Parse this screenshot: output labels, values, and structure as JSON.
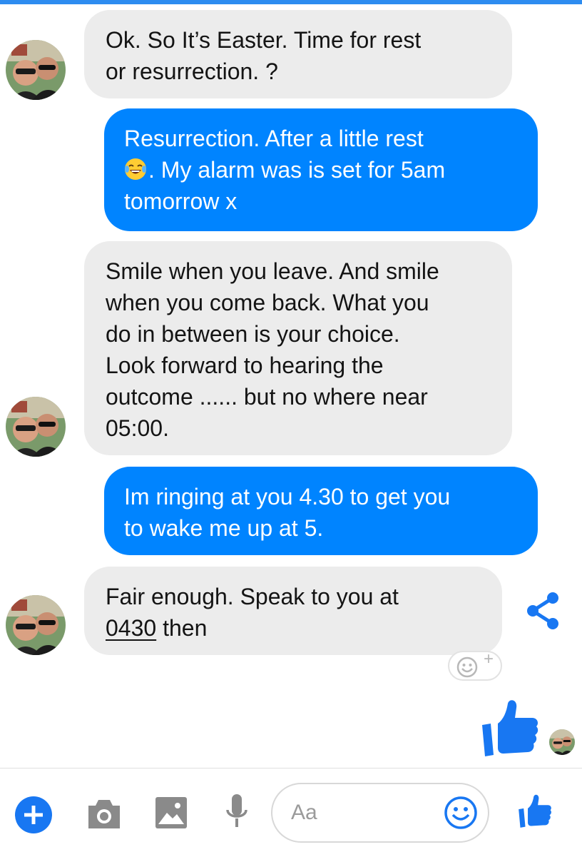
{
  "theme": {
    "accent": "#0084ff",
    "incoming_bg": "#ececec",
    "icon_gray": "#8a8a8a"
  },
  "messages": [
    {
      "direction": "incoming",
      "lines": [
        "Ok. So It’s Easter. Time for rest",
        "or resurrection. ?"
      ]
    },
    {
      "direction": "outgoing",
      "lines": [
        "Resurrection. After a little rest",
        ". My alarm was is set for 5am",
        "tomorrow x"
      ],
      "emoji": "laughing-tears-emoji"
    },
    {
      "direction": "incoming",
      "lines": [
        "Smile when you leave. And smile",
        "when you come back. What you",
        "do in between is your choice.",
        "Look forward to hearing the",
        "outcome ...... but no where near",
        "05:00."
      ]
    },
    {
      "direction": "outgoing",
      "lines": [
        "Im ringing at you 4.30 to get you",
        "to wake me up at 5."
      ]
    },
    {
      "direction": "incoming",
      "lines": [
        "Fair enough. Speak to you at"
      ],
      "link": "0430",
      "after_link": " then"
    }
  ],
  "reaction": {
    "add_label": "+"
  },
  "composer": {
    "placeholder": "Aa",
    "icons": [
      "plus-icon",
      "camera-icon",
      "image-icon",
      "microphone-icon",
      "emoji-icon",
      "thumbs-up-icon"
    ]
  }
}
